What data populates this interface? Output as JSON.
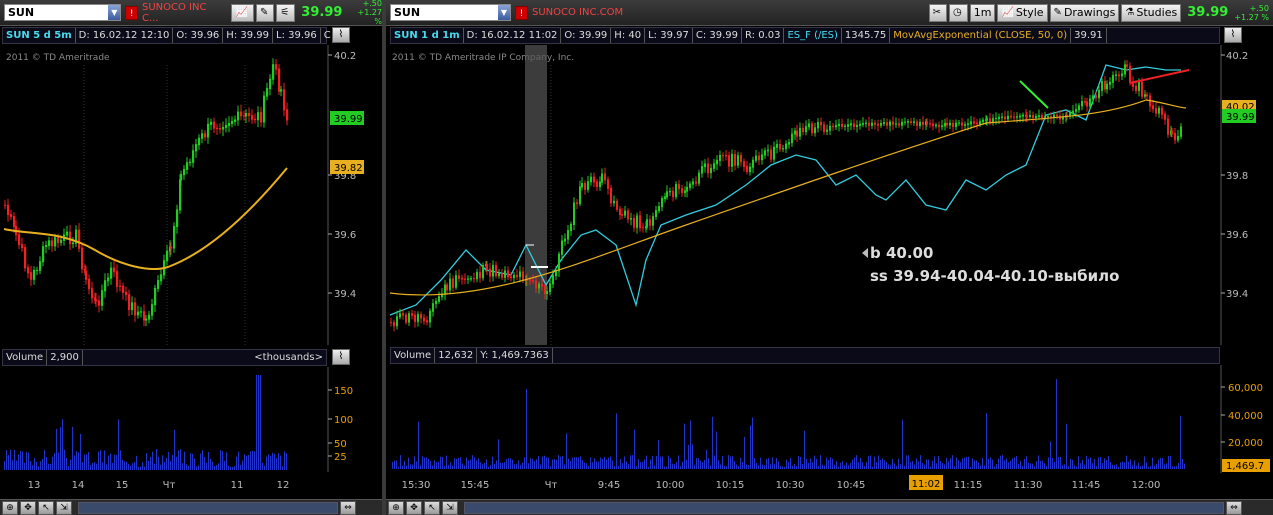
{
  "left": {
    "symbol": "SUN",
    "company": "SUNOCO INC C...",
    "last": "39.99",
    "change_abs": "+.50",
    "change_pct": "+1.27 %",
    "info": {
      "sym": "SUN 5 d 5m",
      "date": "D: 16.02.12 12:10",
      "open": "O: 39.96",
      "high": "H: 39.99",
      "low": "L: 39.96",
      "close": "C"
    },
    "watermark": "2011 © TD Ameritrade",
    "price_ticks": [
      "40.2",
      "39.8",
      "39.6",
      "39.4"
    ],
    "price_label": "39.99",
    "ma_label": "39.82",
    "volume": {
      "label": "Volume",
      "value": "2,900",
      "units": "<thousands>"
    },
    "vol_ticks": [
      "150",
      "100",
      "50",
      "25"
    ],
    "x_ticks": [
      "13",
      "14",
      "15",
      "Чт",
      "11",
      "12"
    ]
  },
  "right": {
    "symbol": "SUN",
    "company": "SUNOCO INC.COM",
    "interval_btn": "1m",
    "style_btn": "Style",
    "drawings_btn": "Drawings",
    "studies_btn": "Studies",
    "last": "39.99",
    "change_abs": "+.50",
    "change_pct": "+1.27 %",
    "info": {
      "sym": "SUN 1 d 1m",
      "date": "D: 16.02.12 11:02",
      "open": "O: 39.99",
      "high": "H: 40",
      "low": "L: 39.97",
      "close": "C: 39.99",
      "range": "R: 0.03",
      "es": "ES_F (/ES)",
      "es_val": "1345.75",
      "ma": "MovAvgExponential (CLOSE, 50, 0)",
      "ma_val": "39.91"
    },
    "watermark": "2011 © TD Ameritrade IP Company, Inc.",
    "price_ticks": [
      "40.2",
      "39.8",
      "39.6",
      "39.4"
    ],
    "price_label": "39.99",
    "ma_label": "40.02",
    "annotation_line1": "b 40.00",
    "annotation_line2": "ss 39.94-40.04-40.10-выбило",
    "volume": {
      "label": "Volume",
      "value": "12,632",
      "y": "Y: 1,469.7363"
    },
    "vol_ticks": [
      "60,000",
      "40,000",
      "20,000"
    ],
    "vol_label": "1,469.7",
    "x_ticks": [
      "15:30",
      "15:45",
      "Чт",
      "9:45",
      "10:00",
      "10:15",
      "10:30",
      "10:45",
      "11:15",
      "11:30",
      "11:45",
      "12:00"
    ],
    "time_label": "11:02"
  },
  "colors": {
    "up": "#22cc22",
    "down": "#ee2222",
    "ma": "#e8b020",
    "es": "#33ccdd",
    "grid": "#333"
  }
}
